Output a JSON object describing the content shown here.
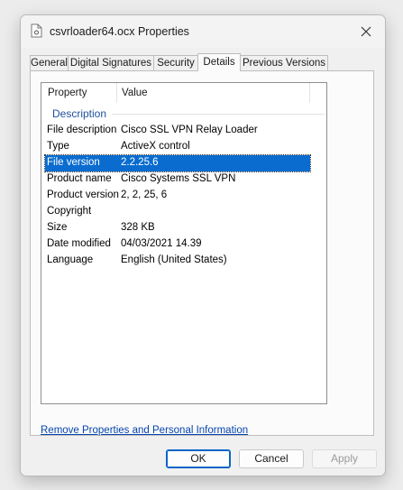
{
  "window": {
    "title": "csvrloader64.ocx Properties",
    "close_icon": "close-icon",
    "file_icon": "file-icon"
  },
  "tabs": [
    {
      "label": "General"
    },
    {
      "label": "Digital Signatures"
    },
    {
      "label": "Security"
    },
    {
      "label": "Details",
      "active": true
    },
    {
      "label": "Previous Versions"
    }
  ],
  "details": {
    "columns": {
      "property": "Property",
      "value": "Value"
    },
    "group": "Description",
    "rows": [
      {
        "property": "File description",
        "value": "Cisco SSL VPN Relay Loader"
      },
      {
        "property": "Type",
        "value": "ActiveX control"
      },
      {
        "property": "File version",
        "value": "2.2.25.6",
        "selected": true
      },
      {
        "property": "Product name",
        "value": "Cisco Systems SSL VPN"
      },
      {
        "property": "Product version",
        "value": "2, 2, 25, 6"
      },
      {
        "property": "Copyright",
        "value": ""
      },
      {
        "property": "Size",
        "value": "328 KB"
      },
      {
        "property": "Date modified",
        "value": "04/03/2021 14.39"
      },
      {
        "property": "Language",
        "value": "English (United States)"
      }
    ]
  },
  "link": "Remove Properties and Personal Information",
  "buttons": {
    "ok": "OK",
    "cancel": "Cancel",
    "apply": "Apply"
  },
  "colors": {
    "selection": "#0a6ccf",
    "link": "#0645ad",
    "group_header": "#1e4f9c"
  }
}
